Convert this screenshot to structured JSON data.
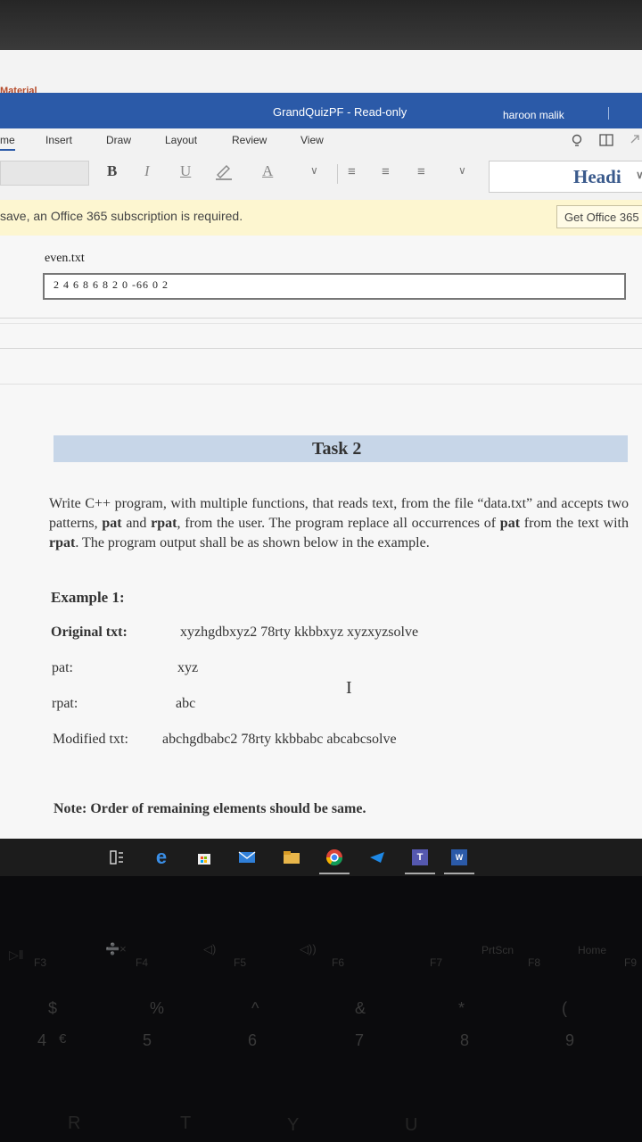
{
  "prev_tab": "Material",
  "window": {
    "title": "GrandQuizPF  -  Read-only",
    "user": "haroon malik"
  },
  "ribbon": {
    "tabs": [
      "me",
      "Insert",
      "Draw",
      "Layout",
      "Review",
      "View"
    ],
    "style_name": "Headi"
  },
  "toolbar": {
    "bold": "B",
    "italic": "I",
    "underline": "U",
    "font_color": "A"
  },
  "notice": {
    "message": " save, an Office 365 subscription is required.",
    "button": "Get Office 365"
  },
  "document": {
    "file_label": "even.txt",
    "file_content": "2 4 6 8 6 8 2 0 -66 0 2",
    "task_title": "Task 2",
    "task_intro": "Write C++ program, with multiple functions, that reads text, from the file “data.txt” and accepts two patterns, ",
    "task_pat": "pat",
    "task_and": " and ",
    "task_rpat": "rpat",
    "task_mid": ", from the user. The program replace all occurrences of ",
    "task_pat2": "pat",
    "task_mid2": " from the text with ",
    "task_rpat2": "rpat",
    "task_end": ". The program output shall be as shown below in the example.",
    "example_title": "Example 1:",
    "original_label": "Original txt:",
    "original_value": "xyzhgdbxyz2 78rty kkbbxyz xyzxyzsolve",
    "pat_label": "pat:",
    "pat_value": "xyz",
    "rpat_label": "rpat:",
    "rpat_value": "abc",
    "modified_label": "Modified txt:",
    "modified_value": "abchgdbabc2 78rty kkbbabc abcabcsolve",
    "note": "Note: Order of remaining elements should be same."
  },
  "taskbar": {
    "icons": [
      "task-view-icon",
      "edge-icon",
      "store-icon",
      "mail-icon",
      "file-explorer-icon",
      "chrome-icon",
      "media-icon",
      "teams-icon",
      "word-icon"
    ],
    "teams_letter": "T",
    "word_letter": "W"
  },
  "keyboard": {
    "fkeys": [
      "F3",
      "F4",
      "F5",
      "F6",
      "F7",
      "F8",
      "F9"
    ],
    "fkey_labels": [
      "PrtScn",
      "Home"
    ],
    "symbols": [
      "$",
      "%",
      "^",
      "&",
      "*",
      "("
    ],
    "digits": [
      "4",
      "5",
      "6",
      "7",
      "8",
      "9"
    ],
    "euro": "€",
    "letters": [
      "R",
      "T",
      "Y",
      "U"
    ]
  }
}
